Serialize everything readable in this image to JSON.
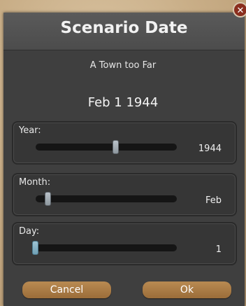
{
  "dialog": {
    "title": "Scenario Date",
    "close_symbol": "✕",
    "scenario_name": "A Town too Far",
    "current_date": "Feb 1 1944"
  },
  "sliders": [
    {
      "label": "Year:",
      "value": "1944",
      "position": 0.57
    },
    {
      "label": "Month:",
      "value": "Feb",
      "position": 0.09
    },
    {
      "label": "Day:",
      "value": "1",
      "position": 0.0
    }
  ],
  "buttons": {
    "cancel": "Cancel",
    "ok": "Ok"
  },
  "colors": {
    "dialog_bg": "#3f3f3f",
    "button": "#aa7b46",
    "close_button": "#8a2e1e"
  },
  "icons": {
    "close": "close-icon"
  }
}
